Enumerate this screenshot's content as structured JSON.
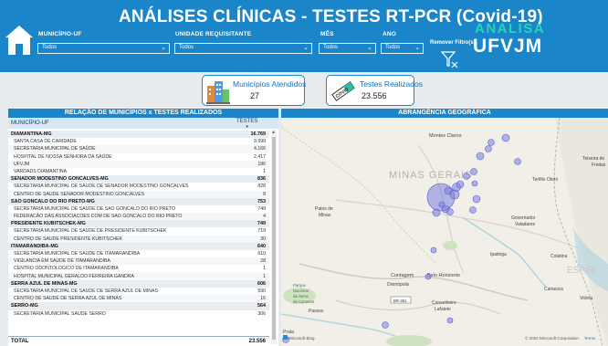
{
  "header": {
    "title": "ANÁLISES CLÍNICAS - TESTES RT-PCR (Covid-19)",
    "filters": [
      {
        "label": "MUNICÍPIO-UF",
        "value": "Todos"
      },
      {
        "label": "UNIDADE REQUISITANTE",
        "value": "Todos"
      },
      {
        "label": "MÊS",
        "value": "Todos"
      },
      {
        "label": "ANO",
        "value": "Todos"
      }
    ],
    "remove_filters": "Remover Filtro(s)",
    "brand_top": "ANALISA",
    "brand_bottom": "UFVJM"
  },
  "cards": {
    "municipios": {
      "label": "Municípios Atendidos",
      "value": "27"
    },
    "testes": {
      "label": "Testes Realizados",
      "value": "23.556",
      "icon_text": "COVID"
    }
  },
  "table": {
    "title": "RELAÇÃO DE MUNICÍPIOS x TESTES REALIZADOS",
    "col1": "MUNICÍPIO-UF",
    "col2": "TESTES",
    "rows": [
      {
        "name": "DIAMANTINA-MG",
        "value": "16.769",
        "group": true
      },
      {
        "name": "SANTA CASA DE CARIDADE",
        "value": "9.999"
      },
      {
        "name": "SECRETARIA MUNICIPAL DE SAÚDE",
        "value": "4.166"
      },
      {
        "name": "HOSPITAL DE NOSSA SENHORA DA SAÚDE",
        "value": "2.417"
      },
      {
        "name": "UFVJM",
        "value": "186"
      },
      {
        "name": "VARDADS DIAMANTINA",
        "value": "1"
      },
      {
        "name": "SENADOR MODESTINO GONCALVES-MG",
        "value": "836",
        "group": true
      },
      {
        "name": "SECRETARIA MUNICIPAL DE SAUDE DE SENADOR MODESTINO GONCALVES",
        "value": "828"
      },
      {
        "name": "CENTRO DE SAUDE SENADOR MODESTINO GONCALVES",
        "value": "8"
      },
      {
        "name": "SAO GONCALO DO RIO PRETO-MG",
        "value": "753",
        "group": true
      },
      {
        "name": "SECRETARIA MUNICIPAL DE SAUDE DE SAO GONCALO DO RIO PRETO",
        "value": "749"
      },
      {
        "name": "FEDERACAO DAS ASSOCIACOES COM DE SAO GONCALO DO RIO PRETO",
        "value": "4"
      },
      {
        "name": "PRESIDENTE KUBITSCHEK-MG",
        "value": "749",
        "group": true
      },
      {
        "name": "SECRETARIA MUNICIPAL DE SAUDE DE PRESIDENTE KUBITSCHEK",
        "value": "719"
      },
      {
        "name": "CENTRO DE SAUDE PRESIDENTE KUBITSCHEK",
        "value": "30"
      },
      {
        "name": "ITAMARANDIBA-MG",
        "value": "640",
        "group": true
      },
      {
        "name": "SECRETARIA MUNICIPAL DE SAUDE DE ITAMARANDIBA",
        "value": "610"
      },
      {
        "name": "VIGILANCIA EM SAUDE DE ITAMARANDIBA",
        "value": "28"
      },
      {
        "name": "CENTRO ODONTOLOGICO DE ITAMARANDIBA",
        "value": "1"
      },
      {
        "name": "HOSPITAL MUNICIPAL GERALDO FERREIRA GANDRA",
        "value": "1"
      },
      {
        "name": "SERRA AZUL DE MINAS-MG",
        "value": "606",
        "group": true
      },
      {
        "name": "SECRETARIA MUNICIPAL DE SAUDE DE SERRA AZUL DE MINAS",
        "value": "590"
      },
      {
        "name": "CENTRO DE SAUDE DE SERRA AZUL DE MINAS",
        "value": "16"
      },
      {
        "name": "SERRO-MG",
        "value": "564",
        "group": true
      },
      {
        "name": "SECRETARIA MUNICIPAL SAUDE SERRO",
        "value": "306"
      }
    ],
    "total_label": "TOTAL",
    "total_value": "23.556"
  },
  "map": {
    "title": "ABRANGÊNCIA GEOGRÁFICA",
    "labels": {
      "montes_claros": "Montes Claros",
      "minas_gerais": "MINAS GERAIS",
      "teofilo_otoni": "Teófilo Otoni",
      "teixeira": "Teixeira de",
      "freitas": "Freitas",
      "patos1": "Patos de",
      "patos2": "Minas",
      "governador1": "Governador",
      "governador2": "Valadares",
      "ipatinga": "Ipatinga",
      "colatina": "Colatina",
      "contagem": "Contagem",
      "belo_horizonte": "Belo Horizonte",
      "divinopolis": "Divinópolis",
      "espirito": "ESPÍRI",
      "cariacica": "Cariacica",
      "vitoria": "Vitória",
      "parque1": "Parque",
      "parque2": "Nacional",
      "parque3": "da Serra",
      "parque4": "da Canastra",
      "passos": "Passos",
      "conselheiro1": "Conselheiro",
      "conselheiro2": "Lafaiete",
      "road": "BR-381",
      "prata": "Prata",
      "bing": "Microsoft Bing",
      "copyright": "© 2022 Microsoft Corporation",
      "terms": "Terms"
    },
    "bubble_color": "#7b7fe0"
  }
}
